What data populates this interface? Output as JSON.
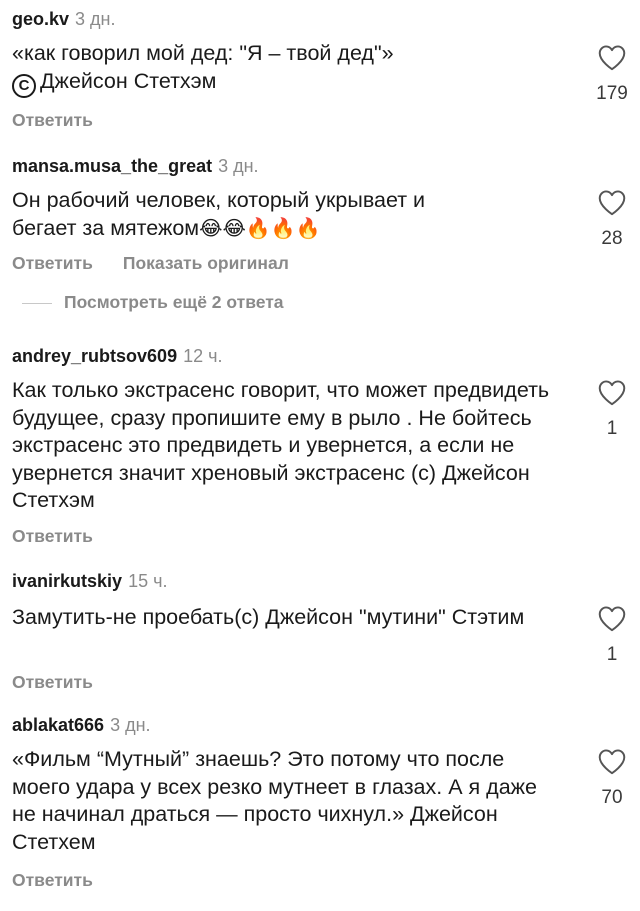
{
  "comments": [
    {
      "username": "geo.kv",
      "time": "3 дн.",
      "text_line1": "«как говорил мой дед: \"Я – твой дед\"»",
      "text_line2": "Джейсон Стетхэм",
      "copyright_symbol": "C",
      "likes": "179",
      "reply_label": "Ответить"
    },
    {
      "username": "mansa.musa_the_great",
      "time": "3 дн.",
      "text": "Он рабочий человек, который укрывает и бегает за мятежом",
      "emojis": "😂😂🔥🔥🔥",
      "likes": "28",
      "reply_label": "Ответить",
      "show_original_label": "Показать оригинал",
      "more_replies_label": "Посмотреть ещё 2 ответа"
    },
    {
      "username": "andrey_rubtsov609",
      "time": "12 ч.",
      "text": "Как только экстрасенс говорит, что может предвидеть будущее, сразу пропишите ему в рыло . Не бойтесь экстрасенс это предвидеть и увернется, а если не увернется значит хреновый экстрасенс (с) Джейсон Стетхэм",
      "likes": "1",
      "reply_label": "Ответить"
    },
    {
      "username": "ivanirkutskiy",
      "time": "15 ч.",
      "text": "Замутить-не проебать(с) Джейсон \"мутини\" Стэтим",
      "likes": "1",
      "reply_label": "Ответить"
    },
    {
      "username": "ablakat666",
      "time": "3 дн.",
      "text": "«Фильм “Мутный” знаешь? Это потому что после моего удара у всех резко мутнеет в глазах. А я даже не начинал драться — просто чихнул.» Джейсон Стетхем",
      "likes": "70",
      "reply_label": "Ответить"
    }
  ],
  "icons": {
    "like": "heart-outline-icon",
    "copyright": "copyright-icon",
    "reply_line": "divider-line"
  },
  "colors": {
    "text": "#1a1a1a",
    "secondary": "#8a8a8a",
    "background": "#ffffff"
  }
}
